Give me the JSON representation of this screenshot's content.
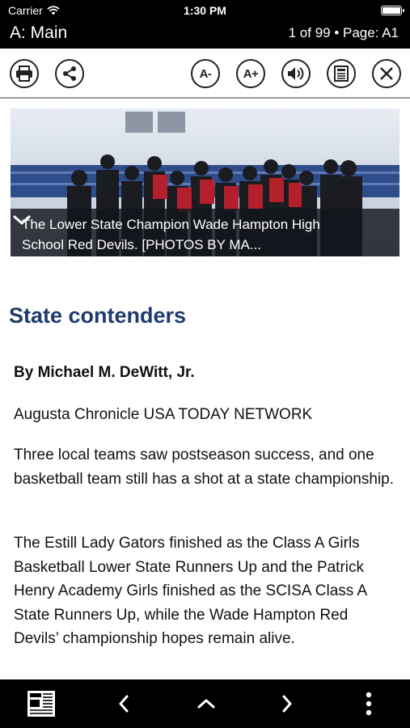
{
  "status_bar": {
    "carrier": "Carrier",
    "time": "1:30 PM",
    "battery_level": 1.0
  },
  "header": {
    "title": "A: Main",
    "page_info": "1 of 99 • Page: A1"
  },
  "toolbar": {
    "print_icon": "printer-icon",
    "share_icon": "share-icon",
    "decrease_font_label": "A-",
    "increase_font_label": "A+",
    "audio_icon": "speaker-icon",
    "page_view_icon": "newspaper-page-icon",
    "close_icon": "close-icon"
  },
  "hero": {
    "caption": "The Lower State Champion Wade Hampton High School Red Devils.  [PHOTOS BY MA..."
  },
  "article": {
    "headline": "State contenders",
    "byline": "By Michael M. DeWitt, Jr.",
    "paragraphs": [
      "Augusta Chronicle USA TODAY NETWORK",
      "Three local teams saw postseason success, and one basketball team still has a shot at a state championship.",
      "The Estill Lady Gators finished as the Class A Girls Basketball Lower State Runners Up and the Patrick Henry Academy Girls finished as the SCISA Class A State Runners Up, while the Wade Hampton Red Devils’ championship hopes remain alive."
    ]
  },
  "bottom_bar": {
    "icons": [
      "newspaper-icon",
      "chevron-left-icon",
      "chevron-up-icon",
      "chevron-right-icon",
      "more-vertical-icon"
    ]
  },
  "colors": {
    "headline": "#1d3b6e",
    "bars": "#000000",
    "caption_overlay": "#14161c"
  }
}
